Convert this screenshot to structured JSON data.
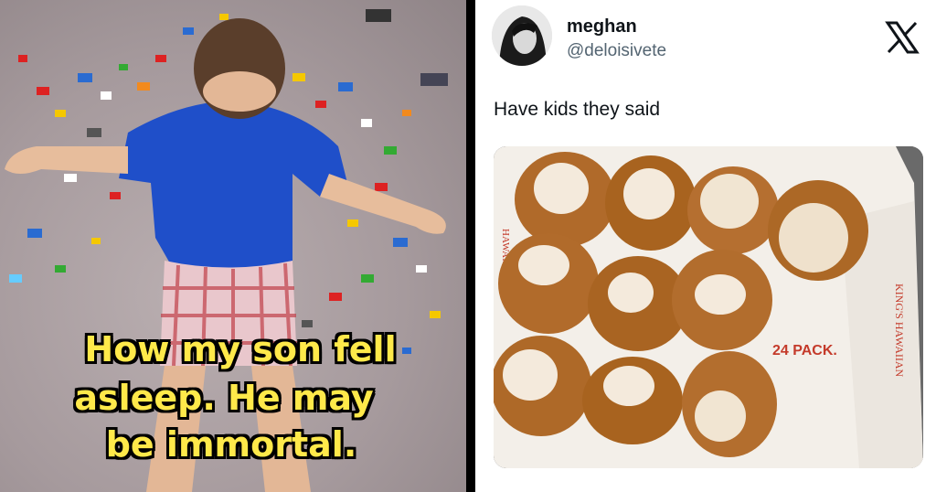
{
  "left_photo": {
    "caption_lines": [
      "How my son fell",
      "asleep. He may",
      "be immortal."
    ]
  },
  "tweet": {
    "display_name": "meghan",
    "handle": "@deloisivete",
    "text": "Have kids they said",
    "platform_logo": "x-logo-icon",
    "photo_box_text": {
      "brand_side": "KING'S HAWAIIAN",
      "brand_left": "HAWAIIAN",
      "pack": "24 PACK."
    }
  },
  "colors": {
    "caption_fill": "#ffe94a",
    "caption_outline": "#000000"
  }
}
